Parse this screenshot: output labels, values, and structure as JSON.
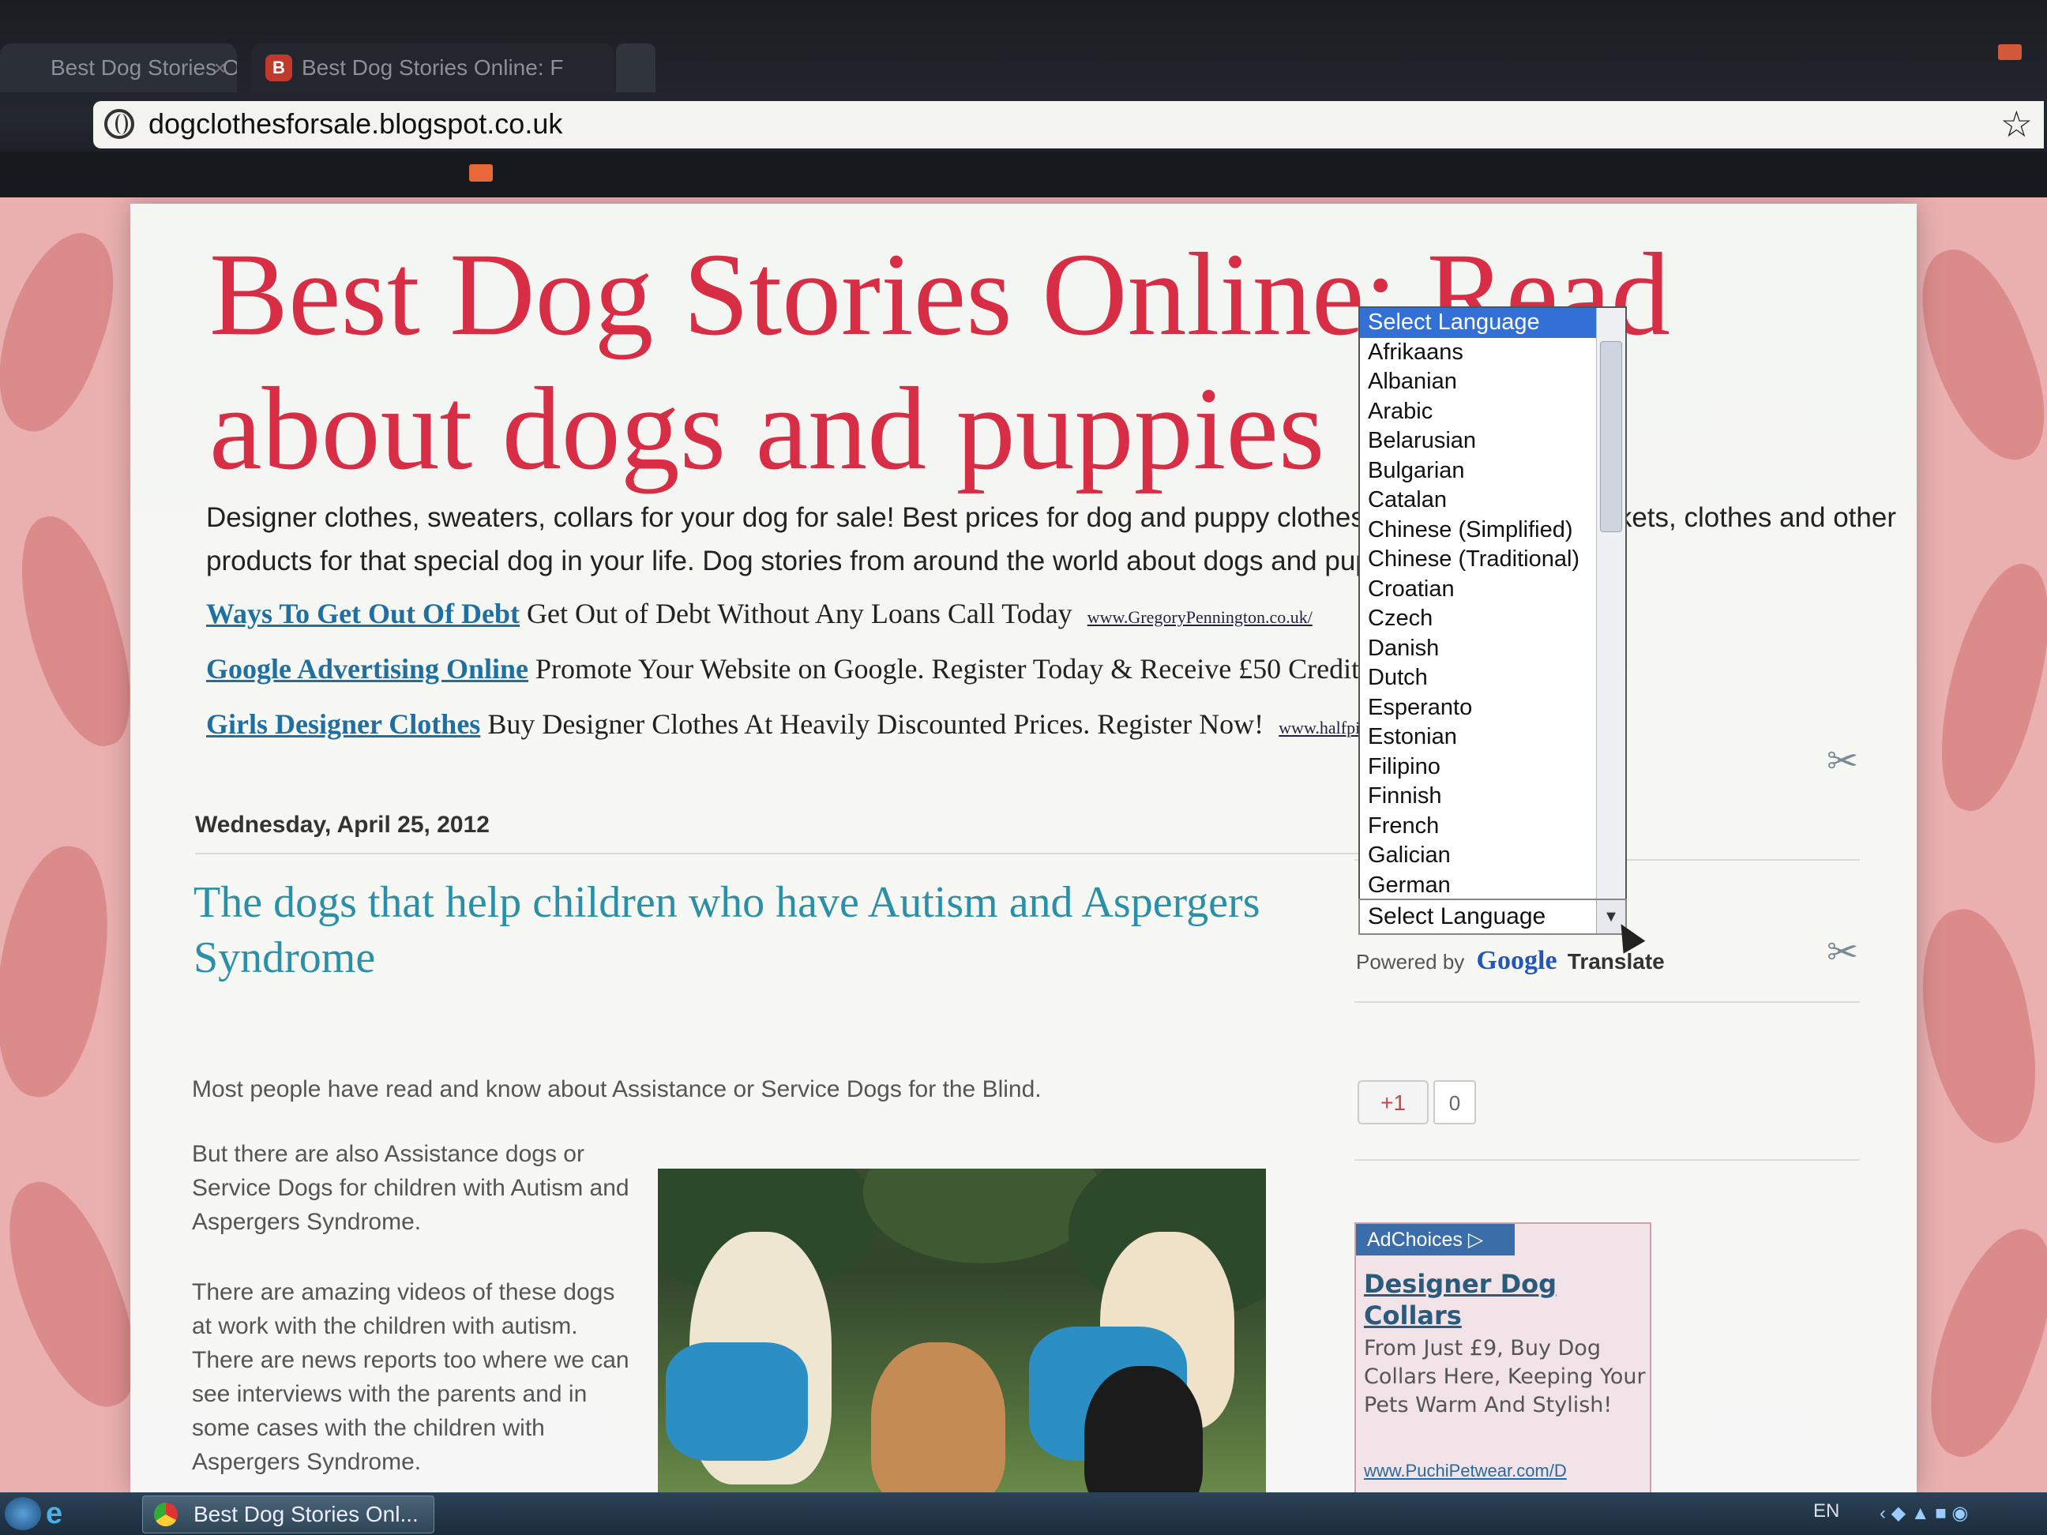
{
  "browser": {
    "tabs": [
      {
        "title": "Best Dog Stories O"
      },
      {
        "title": "Best Dog Stories Online: F"
      },
      {
        "title": ""
      }
    ],
    "url": "dogclothesforsale.blogspot.co.uk"
  },
  "blog": {
    "title": "Best Dog Stories Online: Read about dogs and puppies",
    "description": "Designer clothes, sweaters, collars for your dog for sale! Best prices for dog and puppy clothes, sweaters, hats, baskets, clothes and other products for that special dog in your life. Dog stories from around the world about dogs and puppies."
  },
  "ads": [
    {
      "link": "Ways To Get Out Of Debt",
      "text": "Get Out of Debt Without Any Loans Call Today",
      "url": "www.GregoryPennington.co.uk/"
    },
    {
      "link": "Google Advertising Online",
      "text": "Promote Your Website on Google. Register Today & Receive £50 Credit",
      "url": ""
    },
    {
      "link": "Girls Designer Clothes",
      "text": "Buy Designer Clothes At Heavily Discounted Prices. Register Now!",
      "url": "www.halfpi"
    }
  ],
  "post": {
    "date": "Wednesday, April 25, 2012",
    "title": "The dogs that help children who have Autism and Aspergers Syndrome",
    "paragraph1": "Most people have read and know about Assistance or Service Dogs for the Blind.",
    "paragraph2": "But there are also Assistance dogs or Service Dogs for children with Autism and Aspergers Syndrome.",
    "paragraph3": "There are amazing videos of these dogs at work with the children with autism.  There are news reports too where we can see interviews with the parents and in some cases with the children with Aspergers Syndrome."
  },
  "translate": {
    "select_label": "Select Language",
    "options": [
      "Select Language",
      "Afrikaans",
      "Albanian",
      "Arabic",
      "Belarusian",
      "Bulgarian",
      "Catalan",
      "Chinese (Simplified)",
      "Chinese (Traditional)",
      "Croatian",
      "Czech",
      "Danish",
      "Dutch",
      "Esperanto",
      "Estonian",
      "Filipino",
      "Finnish",
      "French",
      "Galician",
      "German"
    ],
    "powered_by": "Powered by",
    "google": "Google",
    "translate_word": "Translate"
  },
  "plusone": {
    "label": "+1",
    "count": "0"
  },
  "sidebar_ad": {
    "adchoices": "AdChoices",
    "headline": "Designer Dog Collars",
    "body": "From Just £9, Buy Dog Collars Here, Keeping Your Pets Warm And Stylish!",
    "url": "www.PuchiPetwear.com/D"
  },
  "taskbar": {
    "item": "Best Dog Stories Onl...",
    "lang": "EN"
  },
  "icons": [
    "globe-icon",
    "star-icon",
    "tools-icon",
    "cursor-icon",
    "chrome-icon",
    "ie-icon",
    "chevron-down-icon"
  ],
  "colors": {
    "title": "#d72d45",
    "post_title": "#2a8fa8",
    "link": "#1f6fa0",
    "dropdown_selected": "#3370d6"
  }
}
